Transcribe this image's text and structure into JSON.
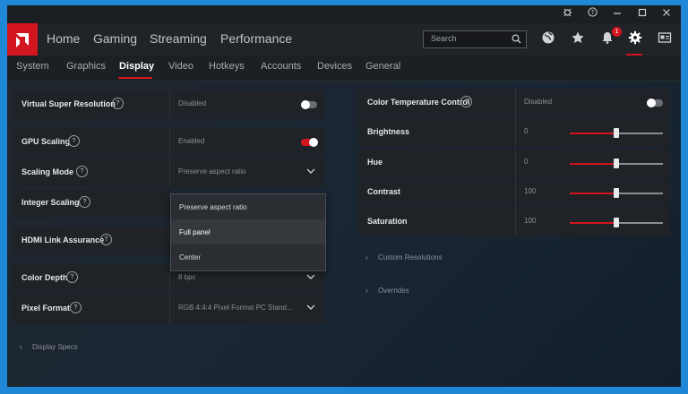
{
  "colors": {
    "accent": "#d3151f",
    "window_bg": "#1a1d21",
    "row_bg": "#1f2226",
    "outer_bg": "#1e87d6"
  },
  "titlebar": {
    "icons": [
      "bug-icon",
      "help-icon",
      "minimize-icon",
      "maximize-icon",
      "close-icon"
    ]
  },
  "topnav": {
    "items": [
      "Home",
      "Gaming",
      "Streaming",
      "Performance"
    ],
    "search_placeholder": "Search",
    "notifications_count": "1"
  },
  "subnav": {
    "items": [
      "System",
      "Graphics",
      "Display",
      "Video",
      "Hotkeys",
      "Accounts",
      "Devices",
      "General"
    ],
    "active": "Display"
  },
  "left_panel": {
    "virtual_super_resolution": {
      "label": "Virtual Super Resolution",
      "value": "Disabled"
    },
    "gpu_scaling": {
      "label": "GPU Scaling",
      "value": "Enabled"
    },
    "scaling_mode": {
      "label": "Scaling Mode",
      "value": "Preserve aspect ratio"
    },
    "integer_scaling": {
      "label": "Integer Scaling"
    },
    "hdmi_link_assurance": {
      "label": "HDMI Link Assurance"
    },
    "color_depth": {
      "label": "Color Depth",
      "value": "8 bpc"
    },
    "pixel_format": {
      "label": "Pixel Format",
      "value": "RGB 4:4:4 Pixel Format PC Stand..."
    },
    "scaling_options": [
      "Preserve aspect ratio",
      "Full panel",
      "Center"
    ],
    "display_specs": "Display Specs"
  },
  "right_panel": {
    "color_temperature": {
      "label": "Color Temperature Control",
      "value": "Disabled"
    },
    "brightness": {
      "label": "Brightness",
      "value": "0",
      "level": 0.5
    },
    "hue": {
      "label": "Hue",
      "value": "0",
      "level": 0.5
    },
    "contrast": {
      "label": "Contrast",
      "value": "100",
      "level": 0.5
    },
    "saturation": {
      "label": "Saturation",
      "value": "100",
      "level": 0.5
    },
    "custom_resolutions": "Custom Resolutions",
    "overrides": "Overrides"
  }
}
